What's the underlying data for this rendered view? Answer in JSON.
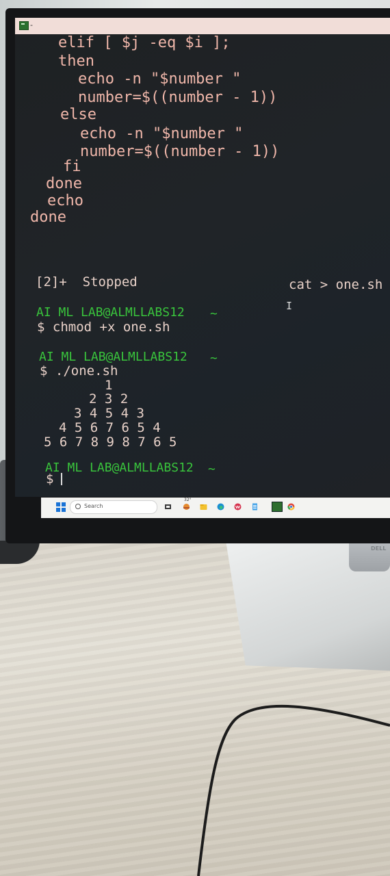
{
  "terminal": {
    "title_text": "-",
    "script_lines": [
      "elif [ $j -eq $i ];",
      "then",
      "echo -n \"$number \"",
      "number=$((number - 1))",
      "else",
      "echo -n \"$number \"",
      "number=$((number - 1))",
      "fi",
      "done",
      "echo",
      "done"
    ],
    "job_status": "[2]+  Stopped",
    "job_command": "cat > one.sh",
    "ibeam": "I",
    "prompts": [
      {
        "user_host": "AI ML LAB@ALMLLABS12",
        "dir": "~",
        "command": "$ chmod +x one.sh"
      },
      {
        "user_host": "AI ML LAB@ALMLLABS12",
        "dir": "~",
        "command": "$ ./one.sh"
      },
      {
        "user_host": "AI ML LAB@ALMLLABS12",
        "dir": "~",
        "command": "$"
      }
    ],
    "output_lines": [
      "1",
      "2 3 2",
      "3 4 5 4 3",
      "4 5 6 7 6 5 4",
      "5 6 7 8 9 8 7 6 5"
    ]
  },
  "taskbar": {
    "search_placeholder": "Search",
    "weather_temp": "32°",
    "icons": [
      "windows-start-icon",
      "search-icon",
      "task-view-icon",
      "weather-icon",
      "file-explorer-icon",
      "edge-icon",
      "wps-office-icon",
      "notepad-icon",
      "mintty-terminal-icon",
      "chrome-icon"
    ]
  },
  "monitor": {
    "brand": "DELL"
  }
}
